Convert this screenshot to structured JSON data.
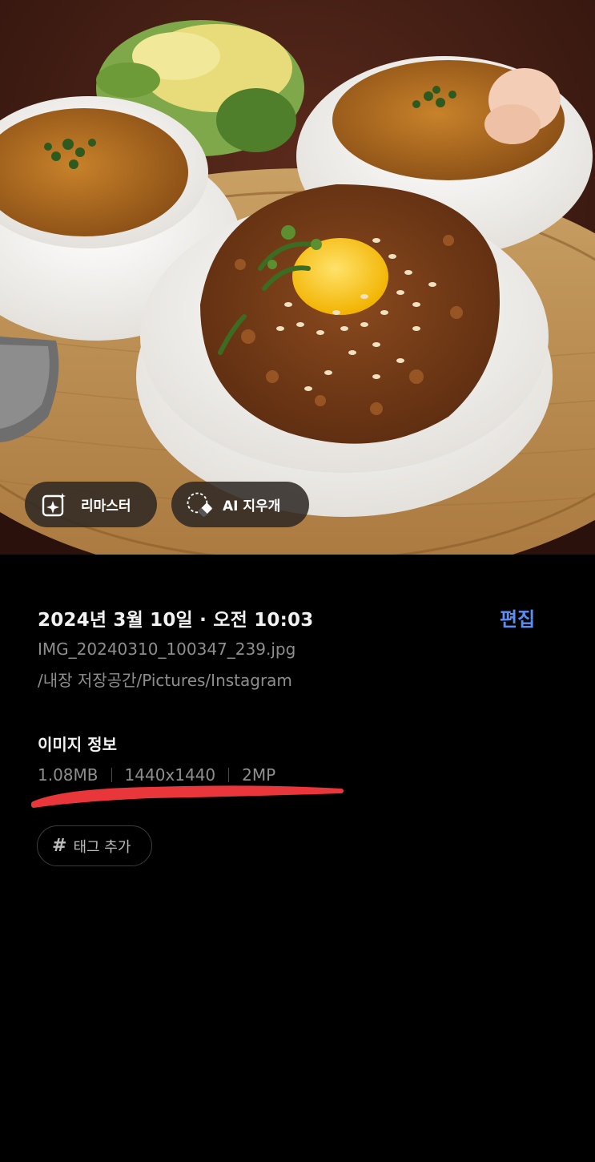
{
  "photo": {
    "alt": "photo",
    "actions": {
      "remaster_label": "리마스터",
      "ai_erase_label": "AI 지우개"
    }
  },
  "details": {
    "datetime": "2024년 3월 10일 · 오전 10:03",
    "edit_label": "편집",
    "filename": "IMG_20240310_100347_239.jpg",
    "path": "/내장 저장공간/Pictures/Instagram"
  },
  "image_info": {
    "title": "이미지 정보",
    "size": "1.08MB",
    "resolution": "1440x1440",
    "megapixels": "2MP"
  },
  "tags": {
    "add_label": "태그 추가",
    "hash_symbol": "#"
  },
  "colors": {
    "accent": "#5b8ef5",
    "annotation_red": "#e8363a",
    "background": "#000000"
  }
}
